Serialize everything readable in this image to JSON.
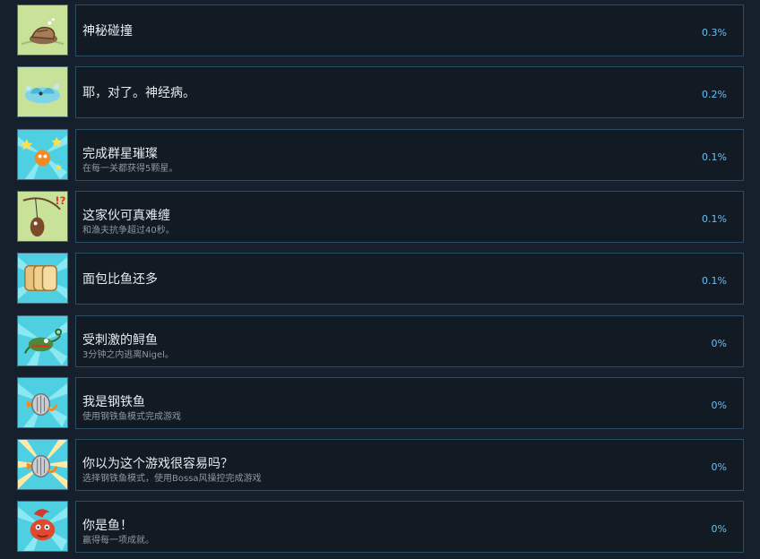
{
  "achievements": [
    {
      "title": "神秘碰撞",
      "description": "",
      "percent": "0.3%",
      "icon": "mystery-collision-icon",
      "background": "#c8e098"
    },
    {
      "title": "耶，对了。神经病。",
      "description": "",
      "percent": "0.2%",
      "icon": "splash-fish-icon",
      "background": "#c8e098"
    },
    {
      "title": "完成群星璀璨",
      "description": "在每一关都获得5颗星。",
      "percent": "0.1%",
      "icon": "star-fish-icon",
      "background": "#5fd8e8"
    },
    {
      "title": "这家伙可真难缠",
      "description": "和渔夫抗争超过40秒。",
      "percent": "0.1%",
      "icon": "hooked-fish-icon",
      "background": "#c8e098"
    },
    {
      "title": "面包比鱼还多",
      "description": "",
      "percent": "0.1%",
      "icon": "bread-icon",
      "background": "#5fd8e8"
    },
    {
      "title": "受刺激的鲟鱼",
      "description": "3分钟之内逃离Nigel。",
      "percent": "0%",
      "icon": "angry-sturgeon-icon",
      "background": "#5fd8e8"
    },
    {
      "title": "我是钢铁鱼",
      "description": "使用钢铁鱼模式完成游戏",
      "percent": "0%",
      "icon": "iron-fish-icon",
      "background": "#5fd8e8"
    },
    {
      "title": "你以为这个游戏很容易吗？",
      "description": "选择钢铁鱼模式，使用Bossa风操控完成游戏",
      "percent": "0%",
      "icon": "iron-fish-burst-icon",
      "background": "#5fd8e8"
    },
    {
      "title": "你是鱼！",
      "description": "赢得每一项成就。",
      "percent": "0%",
      "icon": "red-fish-icon",
      "background": "#5fd8e8"
    }
  ]
}
